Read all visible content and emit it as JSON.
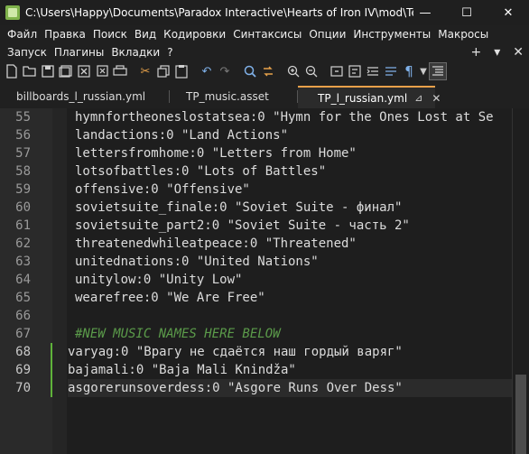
{
  "window": {
    "title": "C:\\Users\\Happy\\Documents\\Paradox Interactive\\Hearts of Iron IV\\mod\\Test P...",
    "minimize": "—",
    "maximize": "☐",
    "close": "✕"
  },
  "menu": {
    "row1": [
      "Файл",
      "Правка",
      "Поиск",
      "Вид",
      "Кодировки",
      "Синтаксисы",
      "Опции",
      "Инструменты",
      "Макросы"
    ],
    "row2": [
      "Запуск",
      "Плагины",
      "Вкладки",
      "?"
    ],
    "right": [
      "+",
      "▾",
      "✕"
    ]
  },
  "toolbar": {
    "icons": [
      "new-file-icon",
      "open-file-icon",
      "save-icon",
      "save-all-icon",
      "close-icon",
      "close-all-icon",
      "print-icon",
      "cut-icon",
      "copy-icon",
      "paste-icon",
      "undo-icon",
      "redo-icon",
      "find-icon",
      "replace-icon",
      "zoom-in-icon",
      "zoom-out-icon",
      "sync-v-icon",
      "wrap-icon",
      "indent-icon",
      "show-all-icon",
      "pilcrow-icon",
      "dropdown-icon",
      "function-list-icon"
    ]
  },
  "tabs": [
    {
      "label": "billboards_l_russian.yml",
      "active": false
    },
    {
      "label": "TP_music.asset",
      "active": false
    },
    {
      "label": "TP_l_russian.yml",
      "active": true,
      "pin": "⊿",
      "close": "✕"
    }
  ],
  "editor": {
    "line_numbers": [
      "55",
      "56",
      "57",
      "58",
      "59",
      "60",
      "61",
      "62",
      "63",
      "64",
      "65",
      "66",
      "67",
      "68",
      "69",
      "70"
    ],
    "lines": [
      "hymnfortheoneslostatsea:0 \"Hymn for the Ones Lost at Se",
      "landactions:0 \"Land Actions\"",
      "lettersfromhome:0 \"Letters from Home\"",
      "lotsofbattles:0 \"Lots of Battles\"",
      "offensive:0 \"Offensive\"",
      "sovietsuite_finale:0 \"Soviet Suite - финал\"",
      "sovietsuite_part2:0 \"Soviet Suite - часть 2\"",
      "threatenedwhileatpeace:0 \"Threatened\"",
      "unitednations:0 \"United Nations\"",
      "unitylow:0 \"Unity Low\"",
      "wearefree:0 \"We Are Free\"",
      "",
      "#NEW MUSIC NAMES HERE BELOW",
      "varyag:0 \"Врагу не сдаётся наш гордый варяг\"",
      "bajamali:0 \"Baja Mali Knindža\"",
      "asgorerunsoverdess:0 \"Asgore Runs Over Dess\""
    ]
  }
}
